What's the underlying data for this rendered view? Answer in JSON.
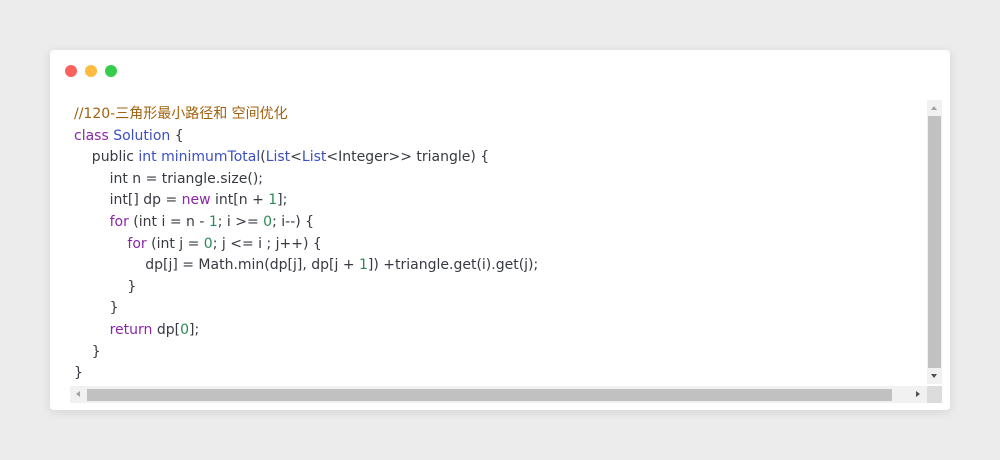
{
  "window": {
    "controls": [
      "close",
      "minimize",
      "maximize"
    ],
    "colors": {
      "close": "#fc625d",
      "minimize": "#fdbc40",
      "maximize": "#35cd4b"
    }
  },
  "code": {
    "colors": {
      "comment": "#a0620f",
      "keyword": "#8c26a8",
      "type": "#3a4fc4",
      "number": "#2b8a57",
      "plain": "#383a42"
    },
    "lines": [
      [
        [
          "comment",
          "//120-三角形最小路径和 空间优化"
        ]
      ],
      [
        [
          "keyword",
          "class "
        ],
        [
          "type",
          "Solution"
        ],
        [
          "plain",
          " {"
        ]
      ],
      [
        [
          "plain",
          "    public "
        ],
        [
          "type",
          "int "
        ],
        [
          "type",
          "minimumTotal"
        ],
        [
          "plain",
          "("
        ],
        [
          "type",
          "List"
        ],
        [
          "plain",
          "<"
        ],
        [
          "type",
          "List"
        ],
        [
          "plain",
          "<Integer>> triangle) {"
        ]
      ],
      [
        [
          "plain",
          "        int n = triangle.size();"
        ]
      ],
      [
        [
          "plain",
          "        int[] dp = "
        ],
        [
          "keyword",
          "new"
        ],
        [
          "plain",
          " int[n + "
        ],
        [
          "num",
          "1"
        ],
        [
          "plain",
          "];"
        ]
      ],
      [
        [
          "plain",
          "        "
        ],
        [
          "keyword",
          "for"
        ],
        [
          "plain",
          " (int i = n - "
        ],
        [
          "num",
          "1"
        ],
        [
          "plain",
          "; i >= "
        ],
        [
          "num",
          "0"
        ],
        [
          "plain",
          "; i--) {"
        ]
      ],
      [
        [
          "plain",
          "            "
        ],
        [
          "keyword",
          "for"
        ],
        [
          "plain",
          " (int j = "
        ],
        [
          "num",
          "0"
        ],
        [
          "plain",
          "; j <= i ; j++) {"
        ]
      ],
      [
        [
          "plain",
          "                dp[j] = Math.min(dp[j], dp[j + "
        ],
        [
          "num",
          "1"
        ],
        [
          "plain",
          "]) +triangle.get(i).get(j);"
        ]
      ],
      [
        [
          "plain",
          "            }"
        ]
      ],
      [
        [
          "plain",
          "        }"
        ]
      ],
      [
        [
          "plain",
          "        "
        ],
        [
          "keyword",
          "return"
        ],
        [
          "plain",
          " dp["
        ],
        [
          "num",
          "0"
        ],
        [
          "plain",
          "];"
        ]
      ],
      [
        [
          "plain",
          "    }"
        ]
      ],
      [
        [
          "plain",
          "}"
        ]
      ]
    ]
  },
  "scrollbars": {
    "vertical": {
      "up_arrow": "arrow-up-icon",
      "down_arrow": "arrow-down-icon"
    },
    "horizontal": {
      "left_arrow": "arrow-left-icon",
      "right_arrow": "arrow-right-icon"
    }
  }
}
